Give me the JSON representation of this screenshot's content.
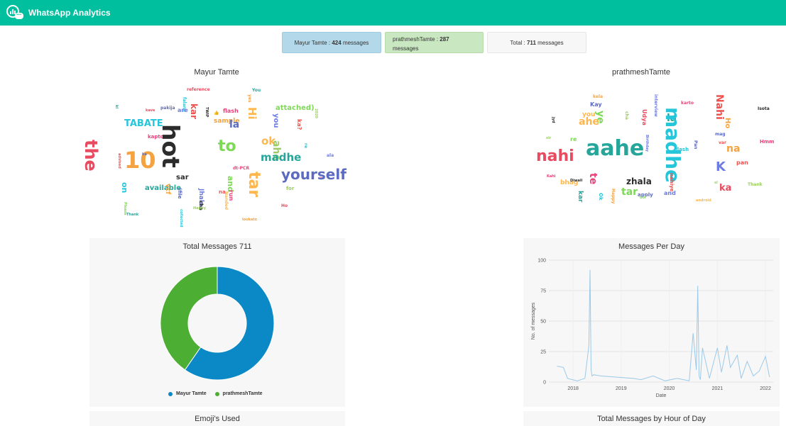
{
  "header": {
    "title": "WhatsApp Analytics",
    "logo_icon": "chart-chat-logo-icon",
    "bg_color": "#00bf9f"
  },
  "stats": [
    {
      "name": "Mayur Tamte",
      "count": "424",
      "suffix": "messages"
    },
    {
      "name": "prathmeshTamte",
      "count": "287",
      "suffix": "messages"
    },
    {
      "name": "Total",
      "count": "711",
      "suffix": "messages"
    }
  ],
  "wordclouds": [
    {
      "title": "Mayur Tamte",
      "words": [
        "reference",
        "You",
        "falane",
        "yes",
        "pakija",
        "are",
        "kar",
        "flash",
        "TWIP",
        "Hi",
        "attached)",
        "2020",
        "kave",
        "ki",
        "TABATE",
        "sample",
        "la",
        "you",
        "ka?",
        "kapto",
        "hot",
        "ok",
        "to",
        "ahe",
        "the",
        "madhe",
        "re",
        "10",
        "ka",
        "ala",
        "advised",
        "dt-PCR",
        "sar",
        "tar",
        "and",
        "for",
        "is",
        "available",
        "on",
        "vcf",
        "(file",
        "Jhala",
        "na",
        "run",
        "cha",
        "Nanded",
        "Please",
        "Happy",
        "Ho",
        "Thank",
        "collected",
        "lookato",
        "yourself",
        "👍"
      ]
    },
    {
      "title": "prathmeshTamte",
      "words": [
        "kela",
        "Kay",
        "interview",
        "Nahi",
        "karto",
        "Isota",
        "you",
        "ye",
        "cha",
        "Udya",
        "la",
        "madhe",
        "Ho",
        "mag",
        "Birthday",
        "var",
        "Hmm",
        "jyd",
        "ahe",
        "re",
        "sir",
        "nahi",
        "aahe",
        "flash",
        "na",
        "Pan",
        "K",
        "pan",
        "te",
        "zhala",
        "bhag",
        "tar",
        "Thank",
        "ka",
        "kar",
        "Ok",
        "Happy",
        "apply",
        "and",
        "nahiye",
        "Kahi",
        "Diwali",
        "android",
        "bol",
        "si"
      ]
    }
  ],
  "donut": {
    "title": "Total Messages 711",
    "chart_data": {
      "type": "pie",
      "categories": [
        "Mayur Tamte",
        "prathmeshTamte"
      ],
      "values": [
        424,
        287
      ],
      "colors": [
        "#0a89c6",
        "#4caf34"
      ],
      "legend": "bottom"
    }
  },
  "line": {
    "title": "Messages Per Day",
    "chart_data": {
      "type": "line",
      "xlabel": "Date",
      "ylabel": "No. of messages",
      "ylim": [
        0,
        100
      ],
      "yticks": [
        "0",
        "25",
        "50",
        "75",
        "100"
      ],
      "xticks": [
        "2018",
        "2019",
        "2020",
        "2021",
        "2022"
      ],
      "grid": true,
      "color": "#9cc9e8",
      "x": [
        "2017-09-01",
        "2017-10-20",
        "2017-11-20",
        "2018-02-01",
        "2018-04-01",
        "2018-05-01",
        "2018-05-10",
        "2018-05-18",
        "2018-05-25",
        "2018-06-05",
        "2018-08-01",
        "2018-12-01",
        "2019-04-01",
        "2019-06-01",
        "2019-09-01",
        "2019-12-01",
        "2020-03-01",
        "2020-06-01",
        "2020-07-01",
        "2020-07-25",
        "2020-08-05",
        "2020-08-15",
        "2020-08-25",
        "2020-09-10",
        "2020-11-01",
        "2021-01-01",
        "2021-02-01",
        "2021-03-15",
        "2021-04-10",
        "2021-06-01",
        "2021-07-01",
        "2021-08-15",
        "2021-10-01",
        "2021-11-15",
        "2022-01-01",
        "2022-02-01"
      ],
      "y": [
        13,
        12,
        3,
        1,
        3,
        30,
        92,
        10,
        5,
        6,
        5,
        4,
        3,
        2,
        5,
        1,
        3,
        1,
        40,
        10,
        79,
        5,
        2,
        28,
        3,
        28,
        8,
        30,
        12,
        22,
        3,
        17,
        5,
        9,
        21,
        4
      ]
    }
  },
  "bottom_panels": [
    "Emoji's Used",
    "Total Messages by Hour of Day"
  ]
}
